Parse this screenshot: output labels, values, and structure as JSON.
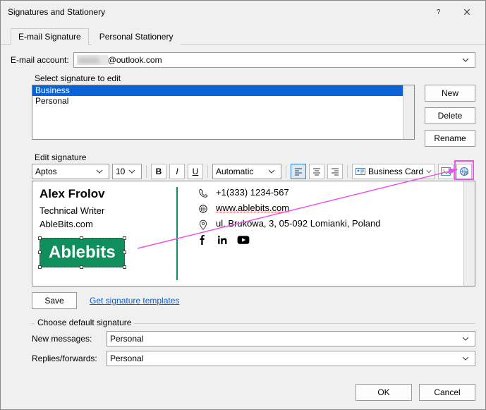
{
  "window": {
    "title": "Signatures and Stationery"
  },
  "tabs": {
    "email": "E-mail Signature",
    "stationery": "Personal Stationery"
  },
  "account": {
    "label": "E-mail account:",
    "domain": "@outlook.com"
  },
  "select_label": "Select signature to edit",
  "signatures": [
    "Business",
    "Personal"
  ],
  "side": {
    "new": "New",
    "delete": "Delete",
    "rename": "Rename"
  },
  "edit_label": "Edit signature",
  "toolbar": {
    "font": "Aptos",
    "size": "10",
    "color": "Automatic",
    "bizcard": "Business Card"
  },
  "sig": {
    "name": "Alex Frolov",
    "role": "Technical Writer",
    "company": "AbleBits.com",
    "logo_text": "Ablebits",
    "phone": "+1(333) 1234-567",
    "web": "www.ablebits.com",
    "addr": "ul. Brukowa, 3, 05-092 Lomianki, Poland"
  },
  "save": "Save",
  "templates_link": "Get signature templates",
  "defaults": {
    "group": "Choose default signature",
    "newmsg_label": "New messages:",
    "newmsg_value": "Personal",
    "replies_label": "Replies/forwards:",
    "replies_value": "Personal"
  },
  "footer": {
    "ok": "OK",
    "cancel": "Cancel"
  }
}
